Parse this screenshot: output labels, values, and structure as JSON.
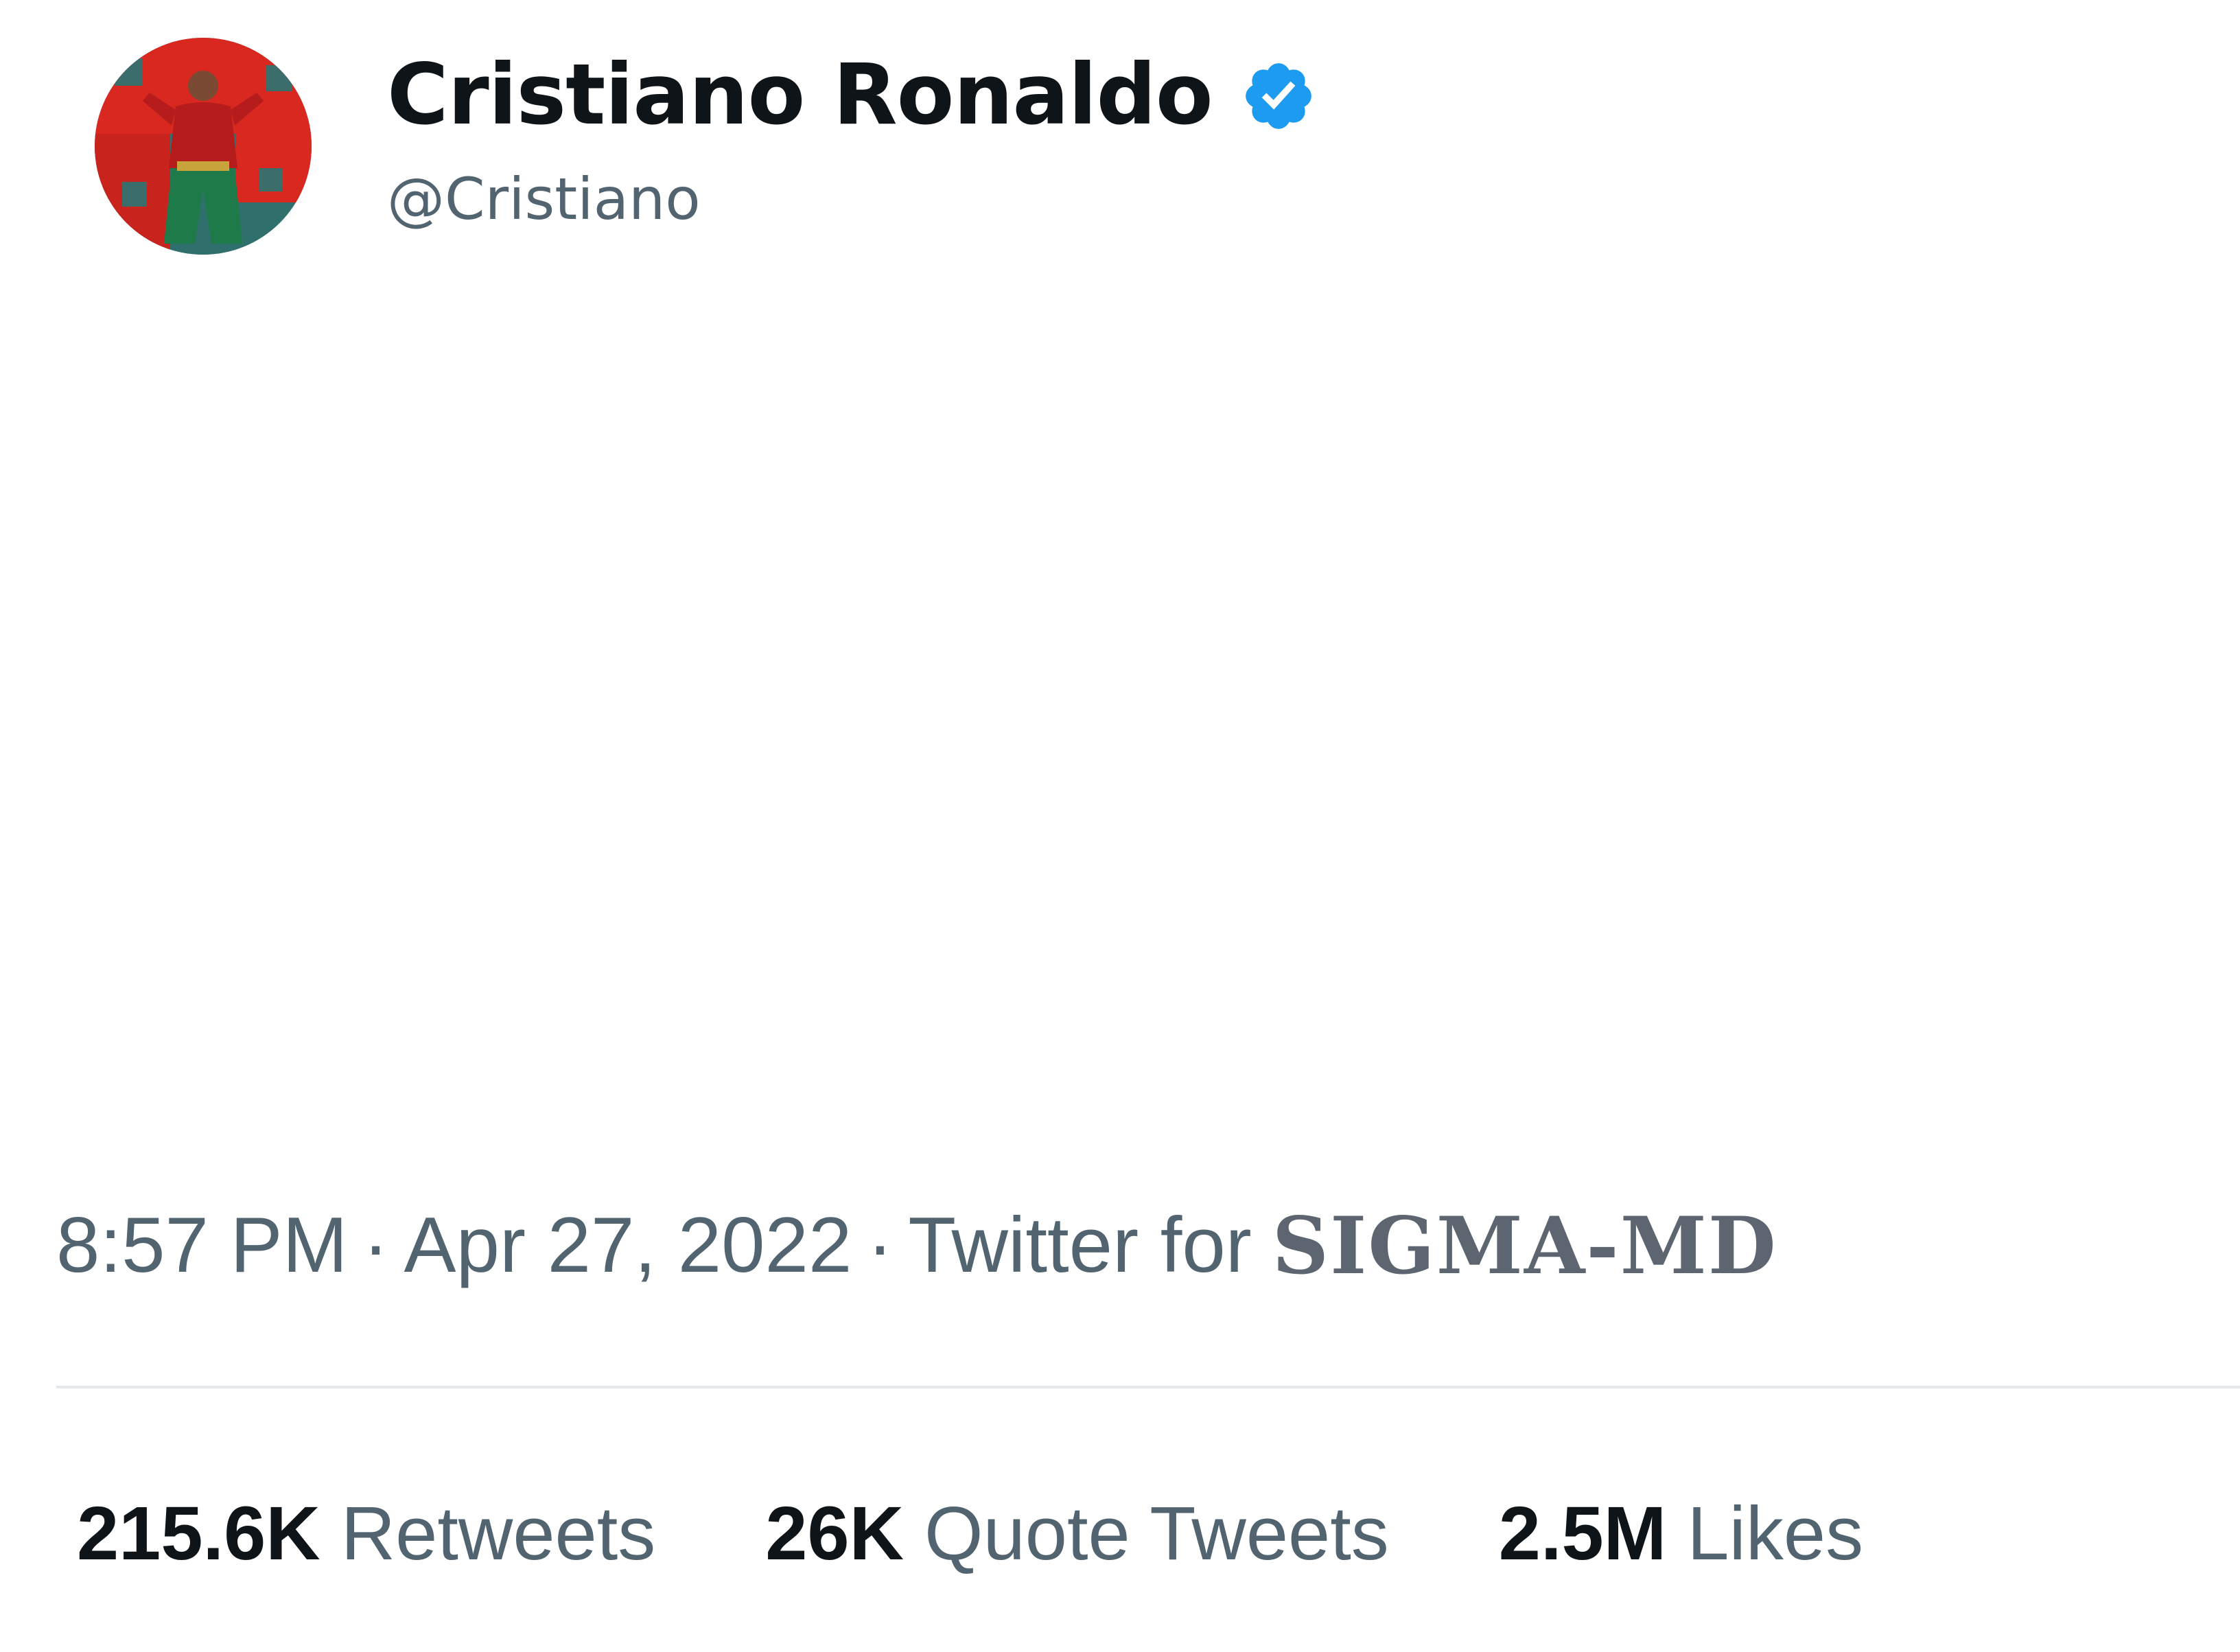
{
  "tweet": {
    "author": {
      "display_name": "Cristiano Ronaldo",
      "handle": "@Cristiano",
      "verified": true,
      "verified_icon": "verified-badge-icon",
      "verified_color": "#1d9bf0",
      "avatar_icon": "profile-photo"
    },
    "meta": {
      "time": "8:57 PM",
      "separator": "·",
      "date": "Apr 27, 2022",
      "client_prefix": "Twitter for",
      "client_name": "SIGMA-MD"
    },
    "stats": {
      "retweets": {
        "count": "215.6K",
        "label": "Retweets"
      },
      "quote_tweets": {
        "count": "26K",
        "label": "Quote Tweets"
      },
      "likes": {
        "count": "2.5M",
        "label": "Likes"
      }
    }
  }
}
